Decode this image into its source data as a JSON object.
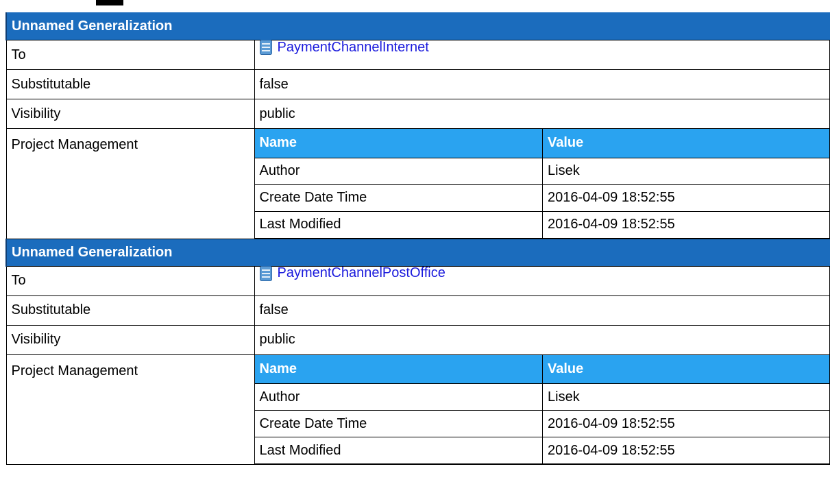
{
  "sections": [
    {
      "header": "Unnamed Generalization",
      "rows": {
        "to_label": "To",
        "to_value": "PaymentChannelInternet",
        "to_icon": "class-icon",
        "substitutable_label": "Substitutable",
        "substitutable_value": "false",
        "visibility_label": "Visibility",
        "visibility_value": "public",
        "pm_label": "Project Management"
      },
      "pm_table": {
        "headers": {
          "name": "Name",
          "value": "Value"
        },
        "rows": [
          {
            "name": "Author",
            "value": "Lisek"
          },
          {
            "name": "Create Date Time",
            "value": "2016-04-09 18:52:55"
          },
          {
            "name": "Last Modified",
            "value": "2016-04-09 18:52:55"
          }
        ]
      }
    },
    {
      "header": "Unnamed Generalization",
      "rows": {
        "to_label": "To",
        "to_value": "PaymentChannelPostOffice",
        "to_icon": "class-icon",
        "substitutable_label": "Substitutable",
        "substitutable_value": "false",
        "visibility_label": "Visibility",
        "visibility_value": "public",
        "pm_label": "Project Management"
      },
      "pm_table": {
        "headers": {
          "name": "Name",
          "value": "Value"
        },
        "rows": [
          {
            "name": "Author",
            "value": "Lisek"
          },
          {
            "name": "Create Date Time",
            "value": "2016-04-09 18:52:55"
          },
          {
            "name": "Last Modified",
            "value": "2016-04-09 18:52:55"
          }
        ]
      }
    }
  ],
  "colors": {
    "section_header_bg": "#1b6cbd",
    "nested_header_bg": "#2aa3f0",
    "link": "#1a1adc",
    "icon_fill": "#4a90d9"
  }
}
